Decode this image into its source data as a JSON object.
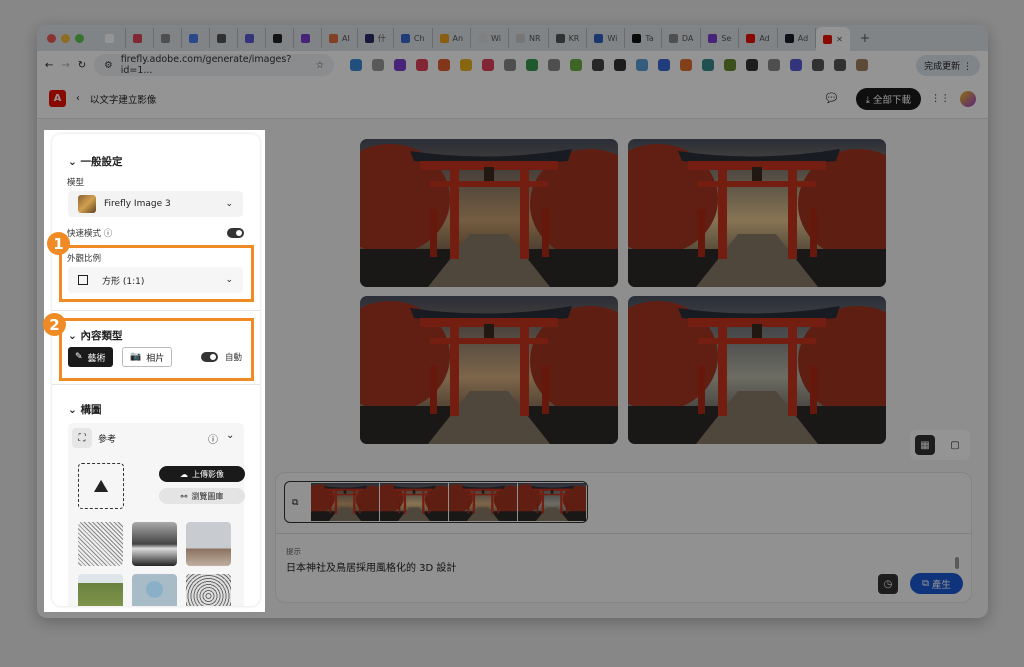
{
  "browser": {
    "tabs": [
      {
        "label": "",
        "color": "#ffffff"
      },
      {
        "label": "",
        "color": "#e0455a"
      },
      {
        "label": "",
        "color": "#888888"
      },
      {
        "label": "",
        "color": "#4a7cf0"
      },
      {
        "label": "",
        "color": "#555555"
      },
      {
        "label": "",
        "color": "#5b5bd6"
      },
      {
        "label": "",
        "color": "#222222"
      },
      {
        "label": "",
        "color": "#7a3fd0"
      },
      {
        "label": "AI",
        "color": "#e07040"
      },
      {
        "label": "什",
        "color": "#2a2a6a"
      },
      {
        "label": "Ch",
        "color": "#3a6ad0"
      },
      {
        "label": "An",
        "color": "#f0a020"
      },
      {
        "label": "Wi",
        "color": "#dddddd"
      },
      {
        "label": "NR",
        "color": "#cccccc"
      },
      {
        "label": "KR",
        "color": "#555555"
      },
      {
        "label": "Wi",
        "color": "#3060c0"
      },
      {
        "label": "Ta",
        "color": "#111111"
      },
      {
        "label": "DA",
        "color": "#888888"
      },
      {
        "label": "Se",
        "color": "#7a3fd0"
      },
      {
        "label": "Ad",
        "color": "#eb1000"
      },
      {
        "label": "Ad",
        "color": "#1a1a2a"
      }
    ],
    "url": "firefly.adobe.com/generate/images?id=1...",
    "update_label": "完成更新"
  },
  "header": {
    "back_label": "以文字建立影像",
    "download_all": "全部下載"
  },
  "sidebar": {
    "general_title": "一般設定",
    "model_label": "模型",
    "model_value": "Firefly Image 3",
    "fast_mode_label": "快速模式",
    "fast_mode_on": true,
    "aspect_label": "外觀比例",
    "aspect_value": "方形 (1:1)",
    "content_type_title": "內容類型",
    "content_art": "藝術",
    "content_photo": "相片",
    "auto_label": "自動",
    "auto_on": true,
    "composition_title": "構圖",
    "reference_label": "參考",
    "upload_label": "上傳影像",
    "browse_label": "瀏覽圖庫"
  },
  "callouts": [
    "1",
    "2"
  ],
  "colors": {
    "accent": "#f08a24",
    "generate": "#1d5bd6",
    "torii": "#c8321e"
  },
  "prompt": {
    "label": "提示",
    "text": "日本神社及鳥居採用風格化的 3D 設計",
    "generate_label": "產生"
  }
}
